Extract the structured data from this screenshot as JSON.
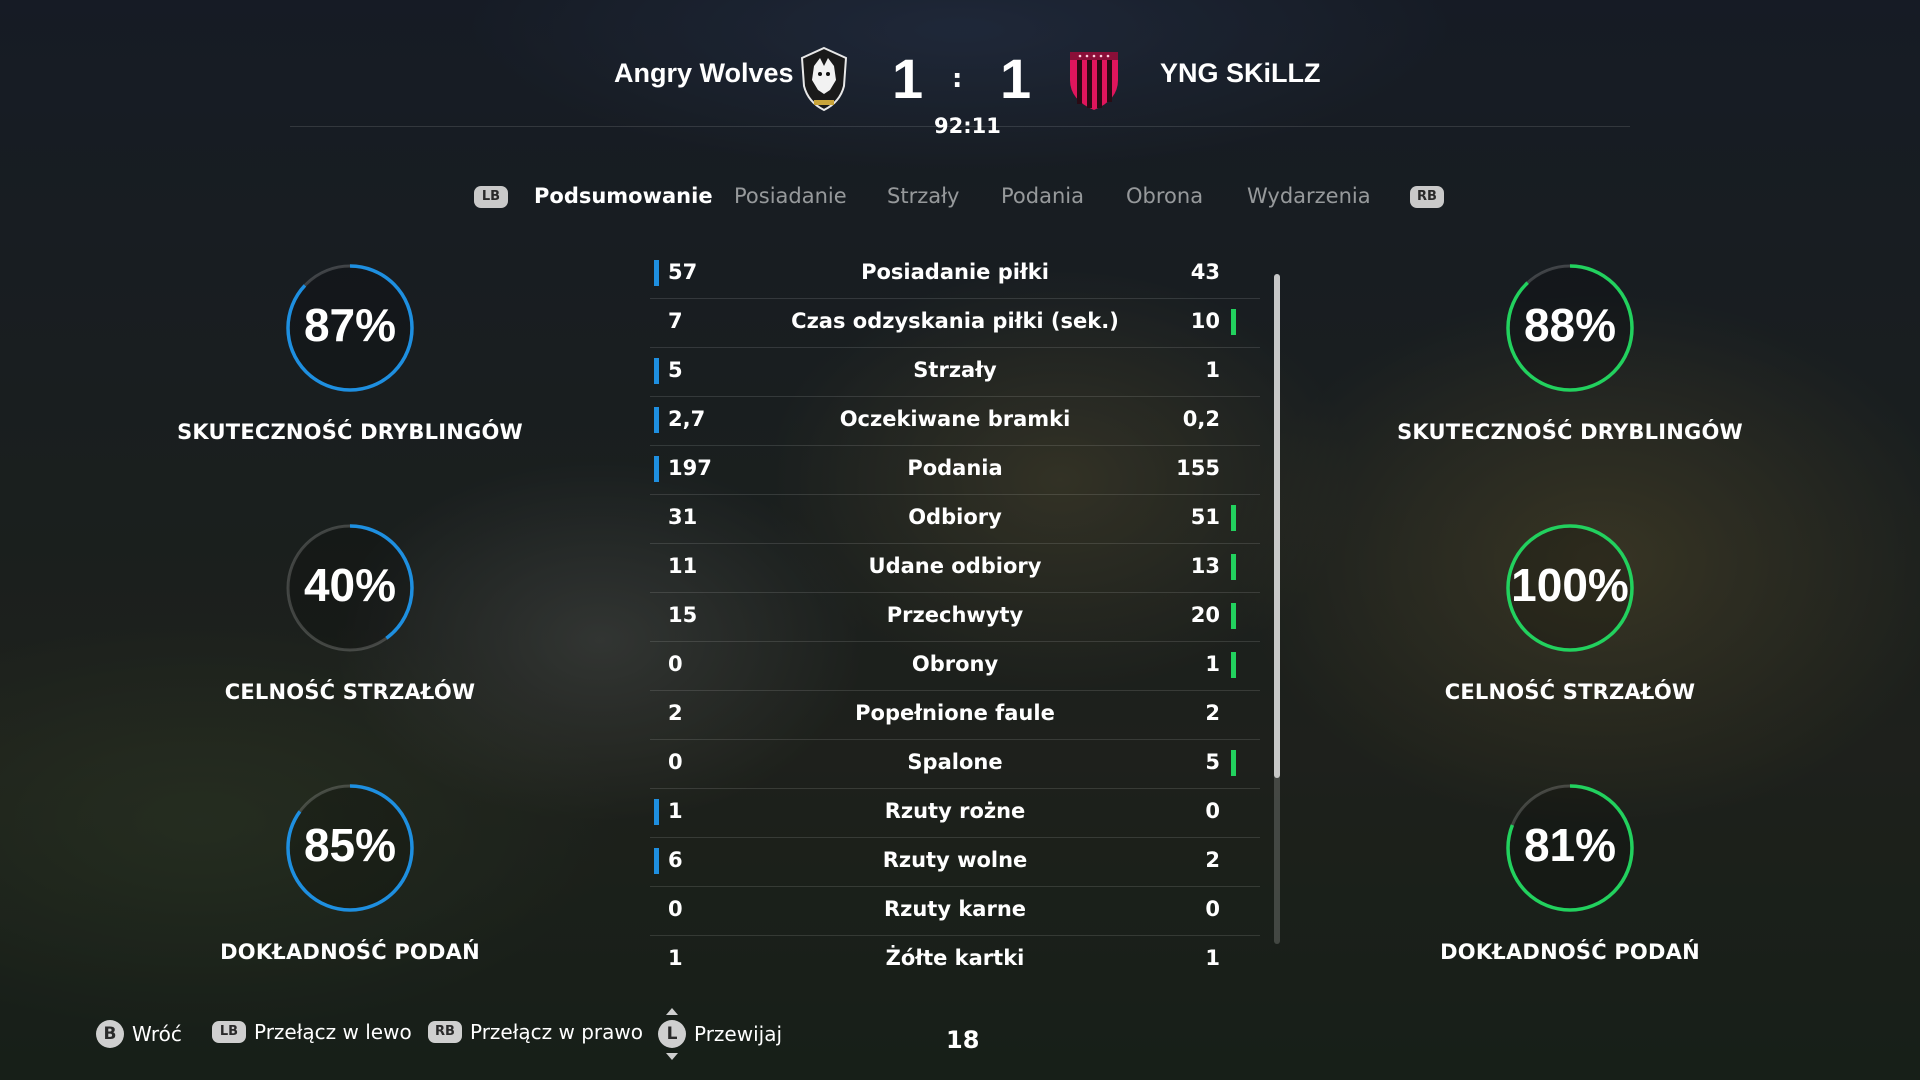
{
  "match": {
    "home_team": "Angry Wolves",
    "away_team": "YNG SKiLLZ",
    "home_score": "1",
    "away_score": "1",
    "separator": ":",
    "clock": "92:11",
    "home_crest_icon": "wolf-crest-icon",
    "away_crest_icon": "striped-shield-crest-icon"
  },
  "tabs": {
    "left_button": "LB",
    "right_button": "RB",
    "items": [
      "Podsumowanie",
      "Posiadanie",
      "Strzały",
      "Podania",
      "Obrona",
      "Wydarzenia"
    ],
    "active_index": 0
  },
  "colors": {
    "home_accent": "#1e8fe0",
    "away_accent": "#22d15e"
  },
  "home_rings": [
    {
      "value": "87%",
      "fraction": 0.87,
      "label": "SKUTECZNOŚĆ DRYBLINGÓW"
    },
    {
      "value": "40%",
      "fraction": 0.4,
      "label": "CELNOŚĆ STRZAŁÓW"
    },
    {
      "value": "85%",
      "fraction": 0.85,
      "label": "DOKŁADNOŚĆ PODAŃ"
    }
  ],
  "away_rings": [
    {
      "value": "88%",
      "fraction": 0.88,
      "label": "SKUTECZNOŚĆ DRYBLINGÓW"
    },
    {
      "value": "100%",
      "fraction": 1.0,
      "label": "CELNOŚĆ STRZAŁÓW"
    },
    {
      "value": "81%",
      "fraction": 0.81,
      "label": "DOKŁADNOŚĆ PODAŃ"
    }
  ],
  "stats": [
    {
      "home": "57",
      "label": "Posiadanie piłki",
      "away": "43",
      "leader": "home"
    },
    {
      "home": "7",
      "label": "Czas odzyskania piłki (sek.)",
      "away": "10",
      "leader": "away"
    },
    {
      "home": "5",
      "label": "Strzały",
      "away": "1",
      "leader": "home"
    },
    {
      "home": "2,7",
      "label": "Oczekiwane bramki",
      "away": "0,2",
      "leader": "home"
    },
    {
      "home": "197",
      "label": "Podania",
      "away": "155",
      "leader": "home"
    },
    {
      "home": "31",
      "label": "Odbiory",
      "away": "51",
      "leader": "away"
    },
    {
      "home": "11",
      "label": "Udane odbiory",
      "away": "13",
      "leader": "away"
    },
    {
      "home": "15",
      "label": "Przechwyty",
      "away": "20",
      "leader": "away"
    },
    {
      "home": "0",
      "label": "Obrony",
      "away": "1",
      "leader": "away"
    },
    {
      "home": "2",
      "label": "Popełnione faule",
      "away": "2",
      "leader": "none"
    },
    {
      "home": "0",
      "label": "Spalone",
      "away": "5",
      "leader": "away"
    },
    {
      "home": "1",
      "label": "Rzuty rożne",
      "away": "0",
      "leader": "home"
    },
    {
      "home": "6",
      "label": "Rzuty wolne",
      "away": "2",
      "leader": "home"
    },
    {
      "home": "0",
      "label": "Rzuty karne",
      "away": "0",
      "leader": "none"
    },
    {
      "home": "1",
      "label": "Żółte kartki",
      "away": "1",
      "leader": "none"
    }
  ],
  "footer": {
    "back": {
      "button": "B",
      "label": "Wróć"
    },
    "left": {
      "button": "LB",
      "label": "Przełącz w lewo"
    },
    "right": {
      "button": "RB",
      "label": "Przełącz w prawo"
    },
    "scroll": {
      "button": "L",
      "label": "Przewijaj"
    },
    "page_number": "18"
  }
}
